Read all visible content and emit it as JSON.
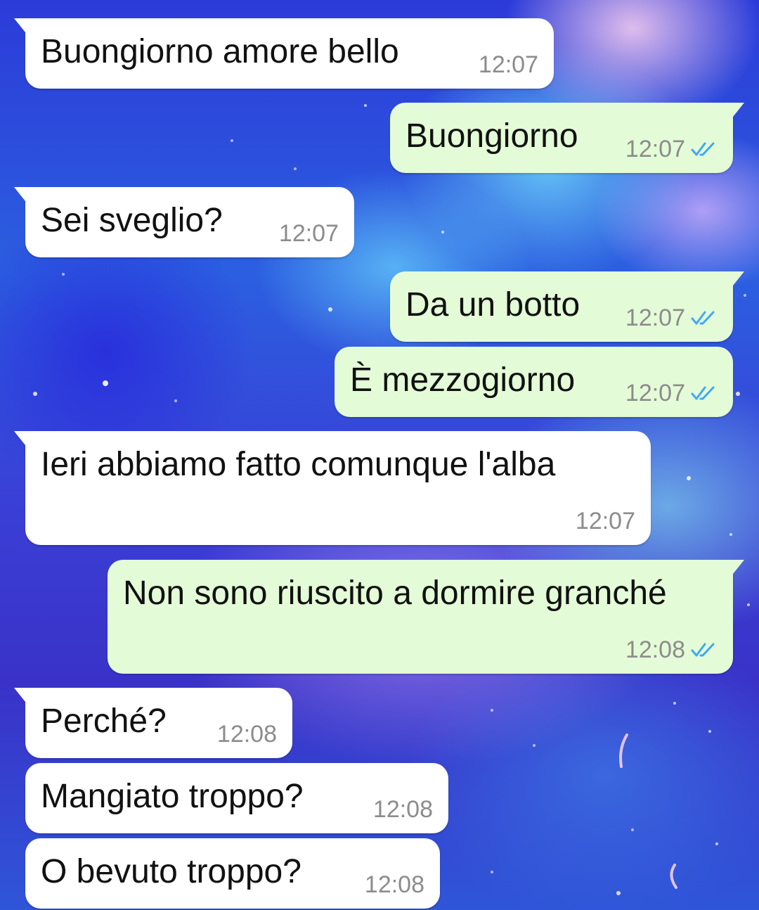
{
  "colors": {
    "incoming_bubble": "#ffffff",
    "outgoing_bubble": "#e4fbd7",
    "read_ticks": "#3fa9f5",
    "timestamp": "#8c8c8c"
  },
  "messages": [
    {
      "direction": "incoming",
      "text": "Buongiorno amore bello",
      "time": "12:07"
    },
    {
      "direction": "outgoing",
      "text": "Buongiorno",
      "time": "12:07",
      "status": "read"
    },
    {
      "direction": "incoming",
      "text": "Sei sveglio?",
      "time": "12:07"
    },
    {
      "direction": "outgoing",
      "text": "Da un botto",
      "time": "12:07",
      "status": "read"
    },
    {
      "direction": "outgoing",
      "text": "È mezzogiorno",
      "time": "12:07",
      "status": "read"
    },
    {
      "direction": "incoming",
      "text": "Ieri abbiamo fatto comunque l'alba",
      "time": "12:07"
    },
    {
      "direction": "outgoing",
      "text": "Non sono riuscito a dormire granché",
      "time": "12:08",
      "status": "read"
    },
    {
      "direction": "incoming",
      "text": "Perché?",
      "time": "12:08"
    },
    {
      "direction": "incoming",
      "text": "Mangiato troppo?",
      "time": "12:08"
    },
    {
      "direction": "incoming",
      "text": "O bevuto troppo?",
      "time": "12:08"
    }
  ]
}
